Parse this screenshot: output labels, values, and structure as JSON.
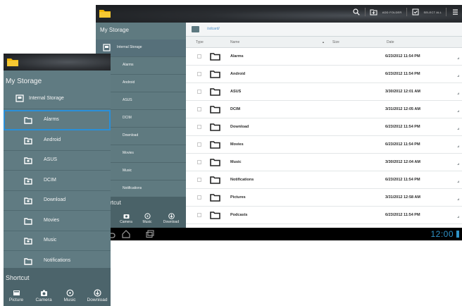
{
  "tablet": {
    "actionbar": {
      "add_folder_label": "ADD FOLDER",
      "select_all_label": "SELECT ALL"
    },
    "sidebar": {
      "title": "My Storage",
      "storage_label": "Internal Storage",
      "items": [
        "Alarms",
        "Android",
        "ASUS",
        "DCIM",
        "Download",
        "Movies",
        "Music",
        "Notifications"
      ],
      "shortcut_title": "Shortcut",
      "shortcuts": [
        "Camera",
        "Music",
        "Download"
      ]
    },
    "path": "/sdcard/",
    "columns": {
      "type": "Type",
      "name": "Name",
      "size": "Size",
      "date": "Date"
    },
    "rows": [
      {
        "name": "Alarms",
        "date": "6/23/2012 11:54 PM"
      },
      {
        "name": "Android",
        "date": "6/23/2012 11:54 PM"
      },
      {
        "name": "ASUS",
        "date": "3/30/2012 12:01 AM"
      },
      {
        "name": "DCIM",
        "date": "3/31/2012 12:05 AM"
      },
      {
        "name": "Download",
        "date": "6/23/2012 11:54 PM"
      },
      {
        "name": "Movies",
        "date": "6/23/2012 11:54 PM"
      },
      {
        "name": "Music",
        "date": "3/30/2012 12:04 AM"
      },
      {
        "name": "Notifications",
        "date": "6/23/2012 11:54 PM"
      },
      {
        "name": "Pictures",
        "date": "3/31/2012 12:58 AM"
      },
      {
        "name": "Podcasts",
        "date": "6/23/2012 11:54 PM"
      }
    ],
    "clock": "12:00",
    "sort_indicator": "▲"
  },
  "front": {
    "title": "My Storage",
    "storage_label": "Internal Storage",
    "items": [
      "Alarms",
      "Android",
      "ASUS",
      "DCIM",
      "Download",
      "Movies",
      "Music",
      "Notifications"
    ],
    "selected_item": "Alarms",
    "shortcut_title": "Shortcut",
    "shortcuts": [
      "Picture",
      "Camera",
      "Music",
      "Download"
    ]
  },
  "colors": {
    "sidebar": "#607b82",
    "selection": "#2a8fd8",
    "clock": "#2f93c8",
    "folder_logo": "#f2b705"
  },
  "icons": {
    "app_logo": "folder-logo-icon",
    "search": "search-icon",
    "add_folder": "add-folder-icon",
    "select_all": "select-all-icon",
    "menu": "overflow-menu-icon",
    "storage": "storage-icon",
    "folder": "folder-icon",
    "camera": "camera-icon",
    "music": "music-icon",
    "download": "download-icon",
    "picture": "picture-icon",
    "back": "back-icon",
    "home": "home-icon",
    "recent": "recent-apps-icon"
  }
}
